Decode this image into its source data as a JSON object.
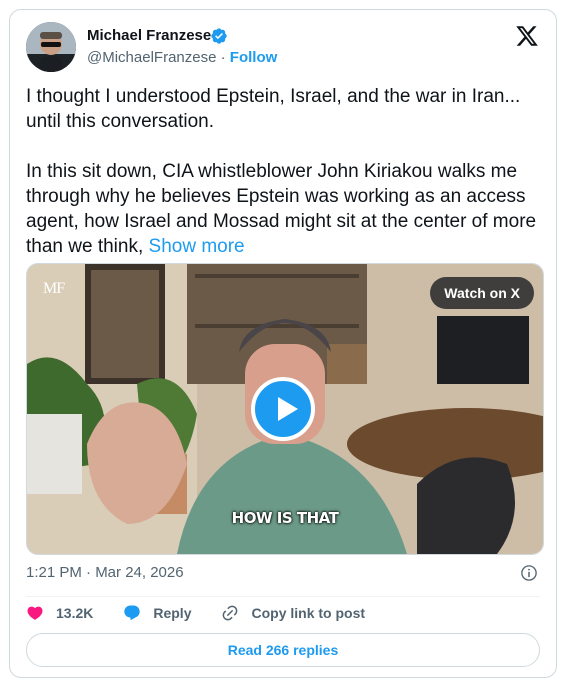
{
  "author": {
    "name": "Michael Franzese",
    "handle": "@MichaelFranzese",
    "separator": "·",
    "follow_label": "Follow"
  },
  "tweet": {
    "paragraph_1": "I thought I understood Epstein, Israel, and the war in Iran... until this conversation.",
    "paragraph_2": "In this sit down, CIA whistleblower John Kiriakou walks me through why he believes Epstein was working as an access agent, how Israel and Mossad might sit at the center of more than we think,",
    "show_more_label": "Show more"
  },
  "media": {
    "watch_label": "Watch on X",
    "logo_text": "MF",
    "caption": "HOW IS THAT"
  },
  "meta": {
    "timestamp": "1:21 PM · Mar 24, 2026"
  },
  "actions": {
    "likes_count": "13.2K",
    "reply_label": "Reply",
    "copy_link_label": "Copy link to post"
  },
  "replies_button_label": "Read 266 replies",
  "colors": {
    "accent": "#1d9bf0",
    "like": "#f91880",
    "text": "#0f1419",
    "secondary": "#536471"
  }
}
